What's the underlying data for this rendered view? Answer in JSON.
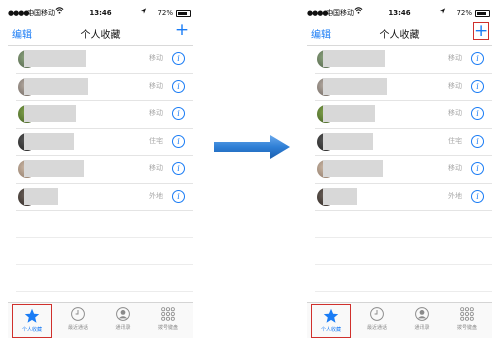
{
  "phones": [
    {
      "status": {
        "signal": "●●●●○",
        "carrier": "中国移动",
        "time": "13:46",
        "battery": "72%"
      },
      "nav": {
        "edit": "编辑",
        "title": "个人收藏",
        "add": "+"
      },
      "contacts": [
        {
          "type": "移动"
        },
        {
          "type": "移动"
        },
        {
          "type": "移动"
        },
        {
          "type": "住宅"
        },
        {
          "type": "移动"
        },
        {
          "type": "外地"
        }
      ],
      "tabs": [
        {
          "label": "个人收藏"
        },
        {
          "label": "最近通话"
        },
        {
          "label": "通讯录"
        },
        {
          "label": "拨号键盘"
        }
      ]
    },
    {
      "status": {
        "signal": "●●●●○",
        "carrier": "中国移动",
        "time": "13:46",
        "battery": "72%"
      },
      "nav": {
        "edit": "编辑",
        "title": "个人收藏",
        "add": "+"
      },
      "contacts": [
        {
          "type": "移动"
        },
        {
          "type": "移动"
        },
        {
          "type": "移动"
        },
        {
          "type": "住宅"
        },
        {
          "type": "移动"
        },
        {
          "type": "外地"
        }
      ],
      "tabs": [
        {
          "label": "个人收藏"
        },
        {
          "label": "最近通话"
        },
        {
          "label": "通讯录"
        },
        {
          "label": "拨号键盘"
        }
      ]
    }
  ],
  "colors": {
    "accent": "#1a7cf5",
    "highlight": "#d0302c",
    "arrow": "#2f7fd6"
  }
}
